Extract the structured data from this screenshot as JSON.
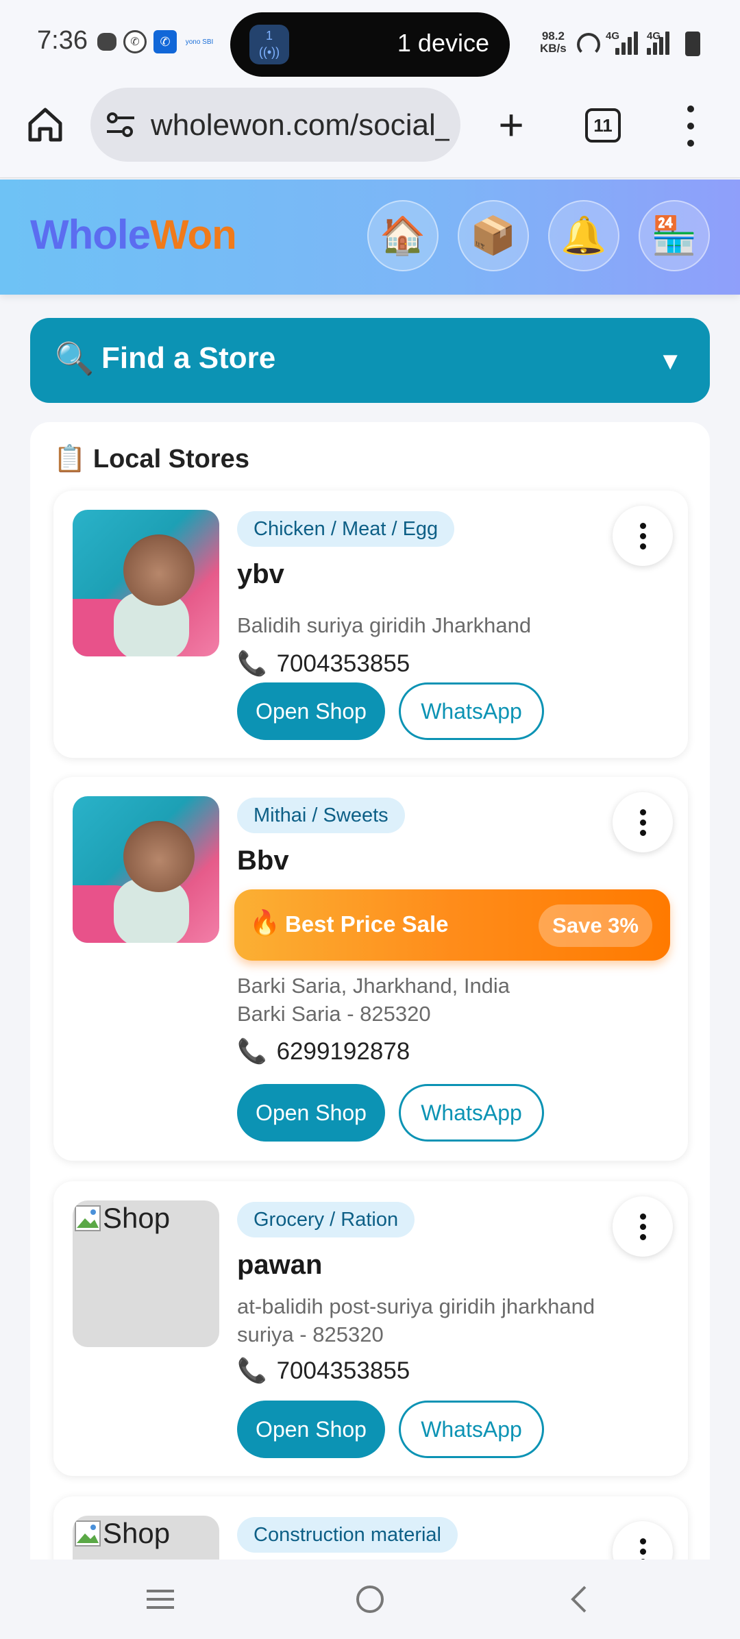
{
  "status_bar": {
    "time": "7:36",
    "pill_icon_label": "1",
    "pill_text": "1 device",
    "net_speed_value": "98.2",
    "net_speed_unit": "KB/s",
    "sim1_label": "4G",
    "sim2_label": "4G",
    "yono_label": "yono SBI"
  },
  "browser": {
    "url": "wholewon.com/social_",
    "tab_count": "11"
  },
  "app_header": {
    "logo_part1": "Whole",
    "logo_part2": "Won",
    "icons": [
      "🏠",
      "📦",
      "🔔",
      "🏪"
    ]
  },
  "find_store": {
    "icon": "🔍",
    "label": "Find a Store",
    "caret": "▼"
  },
  "stores_section": {
    "title": "📋 Local Stores",
    "open_label": "Open Shop",
    "whatsapp_label": "WhatsApp",
    "phone_icon": "📞",
    "broken_image_alt": "Shop"
  },
  "stores": [
    {
      "category": "Chicken / Meat / Egg",
      "name": "ybv",
      "address_line1": "Balidih suriya giridih Jharkhand",
      "address_line2": "",
      "phone": "7004353855"
    },
    {
      "category": "Mithai / Sweets",
      "name": "Bbv",
      "sale_icon": "🔥",
      "sale_text": "Best Price Sale",
      "sale_save": "Save 3%",
      "address_line1": "Barki Saria, Jharkhand, India",
      "address_line2": "Barki Saria - 825320",
      "phone": "6299192878"
    },
    {
      "category": "Grocery / Ration",
      "name": "pawan",
      "address_line1": "at-balidih post-suriya giridih jharkhand",
      "address_line2": "suriya - 825320",
      "phone": "7004353855"
    },
    {
      "category": "Construction material"
    }
  ],
  "colors": {
    "primary": "#0c93b4",
    "logo_blue": "#5b6df0",
    "logo_orange": "#f07a1a",
    "sale_orange": "#ff8c1a"
  }
}
